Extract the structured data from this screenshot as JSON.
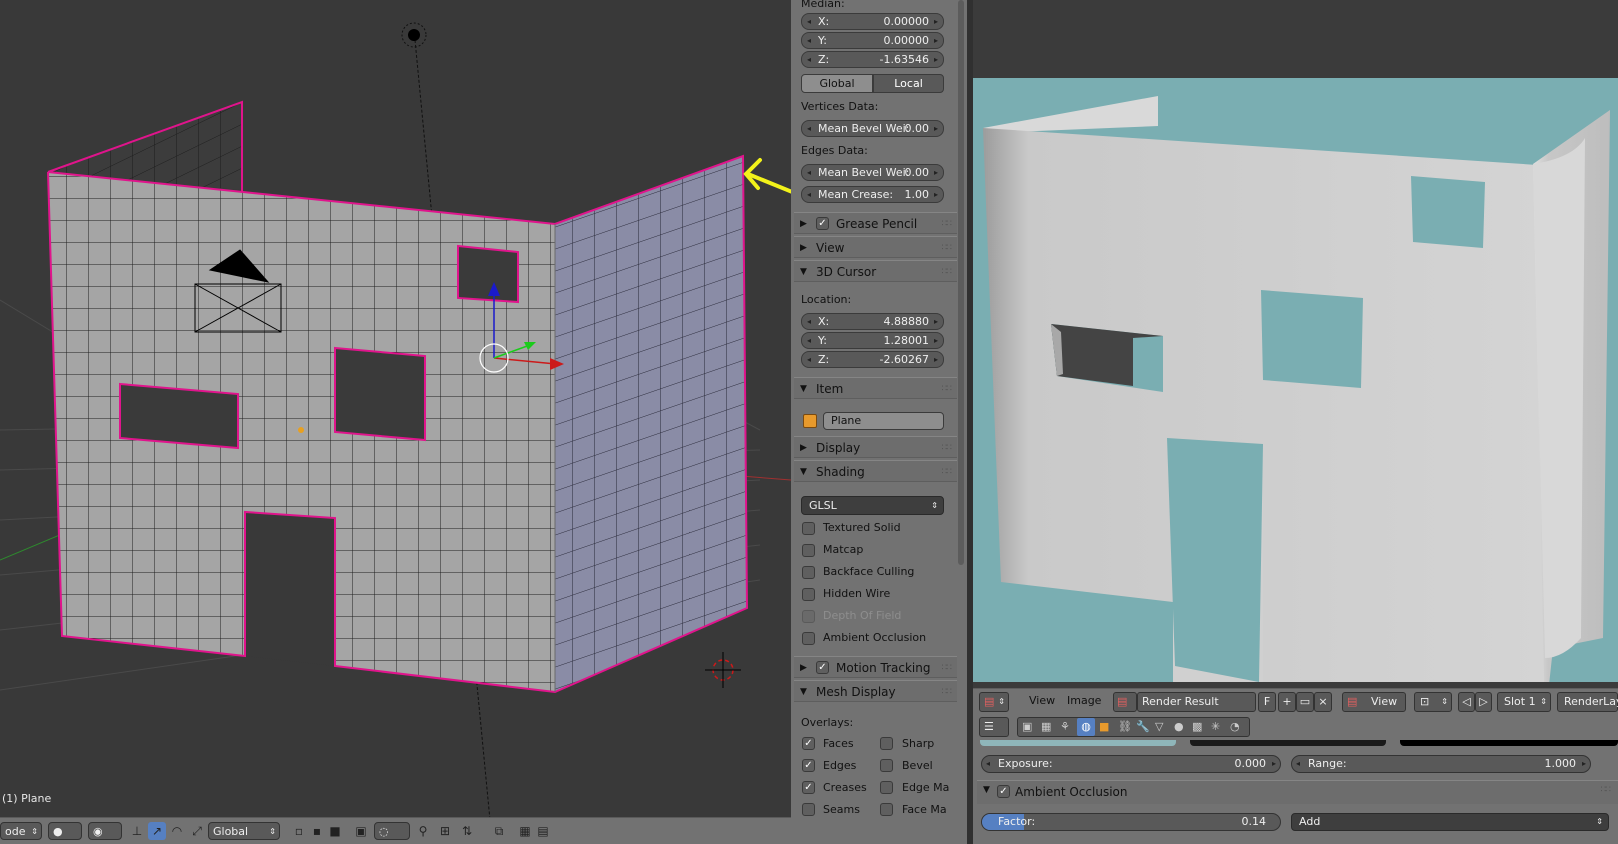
{
  "viewport": {
    "object_label": "(1) Plane",
    "header": {
      "mode": "ode",
      "orientation": "Global"
    }
  },
  "properties": {
    "transform": {
      "median_label": "Median:",
      "x_label": "X:",
      "x": "0.00000",
      "y_label": "Y:",
      "y": "0.00000",
      "z_label": "Z:",
      "z": "-1.63546",
      "global": "Global",
      "local": "Local",
      "vertices_data": "Vertices Data:",
      "vert_bevel_label": "Mean Bevel Wei:",
      "vert_bevel": "0.00",
      "edges_data": "Edges Data:",
      "edge_bevel_label": "Mean Bevel Wei:",
      "edge_bevel": "0.00",
      "crease_label": "Mean Crease:",
      "crease": "1.00"
    },
    "panels": {
      "grease_pencil": "Grease Pencil",
      "view": "View",
      "cursor": "3D Cursor",
      "item": "Item",
      "display": "Display",
      "shading": "Shading",
      "motion_tracking": "Motion Tracking",
      "mesh_display": "Mesh Display"
    },
    "cursor": {
      "location": "Location:",
      "x_label": "X:",
      "x": "4.88880",
      "y_label": "Y:",
      "y": "1.28001",
      "z_label": "Z:",
      "z": "-2.60267"
    },
    "item": {
      "name": "Plane"
    },
    "shading": {
      "mode": "GLSL",
      "textured_solid": "Textured Solid",
      "matcap": "Matcap",
      "backface_culling": "Backface Culling",
      "hidden_wire": "Hidden Wire",
      "depth_of_field": "Depth Of Field",
      "ambient_occlusion": "Ambient Occlusion"
    },
    "mesh_display": {
      "overlays": "Overlays:",
      "faces": "Faces",
      "sharp": "Sharp",
      "edges": "Edges",
      "bevel": "Bevel",
      "creases": "Creases",
      "edge_marks": "Edge Ma",
      "seams": "Seams",
      "face_marks": "Face Ma"
    }
  },
  "image_editor": {
    "menu_view": "View",
    "menu_image": "Image",
    "image_name": "Render Result",
    "fake_user": "F",
    "view_mode": "View",
    "slot": "Slot 1",
    "render_layer": "RenderLay",
    "exposure_label": "Exposure:",
    "exposure": "0.000",
    "range_label": "Range:",
    "range": "1.000",
    "ao_panel": "Ambient Occlusion",
    "factor_label": "Factor:",
    "factor": "0.14",
    "blend": "Add"
  },
  "colors": {
    "viewport_bg": "#393939",
    "render_bg": "#7aaeb2",
    "wall_face": "#a3a3a3",
    "wall_side": "#8a8ca6",
    "crease_edge": "#e0148c",
    "annotation_arrow": "#f2f21a"
  }
}
